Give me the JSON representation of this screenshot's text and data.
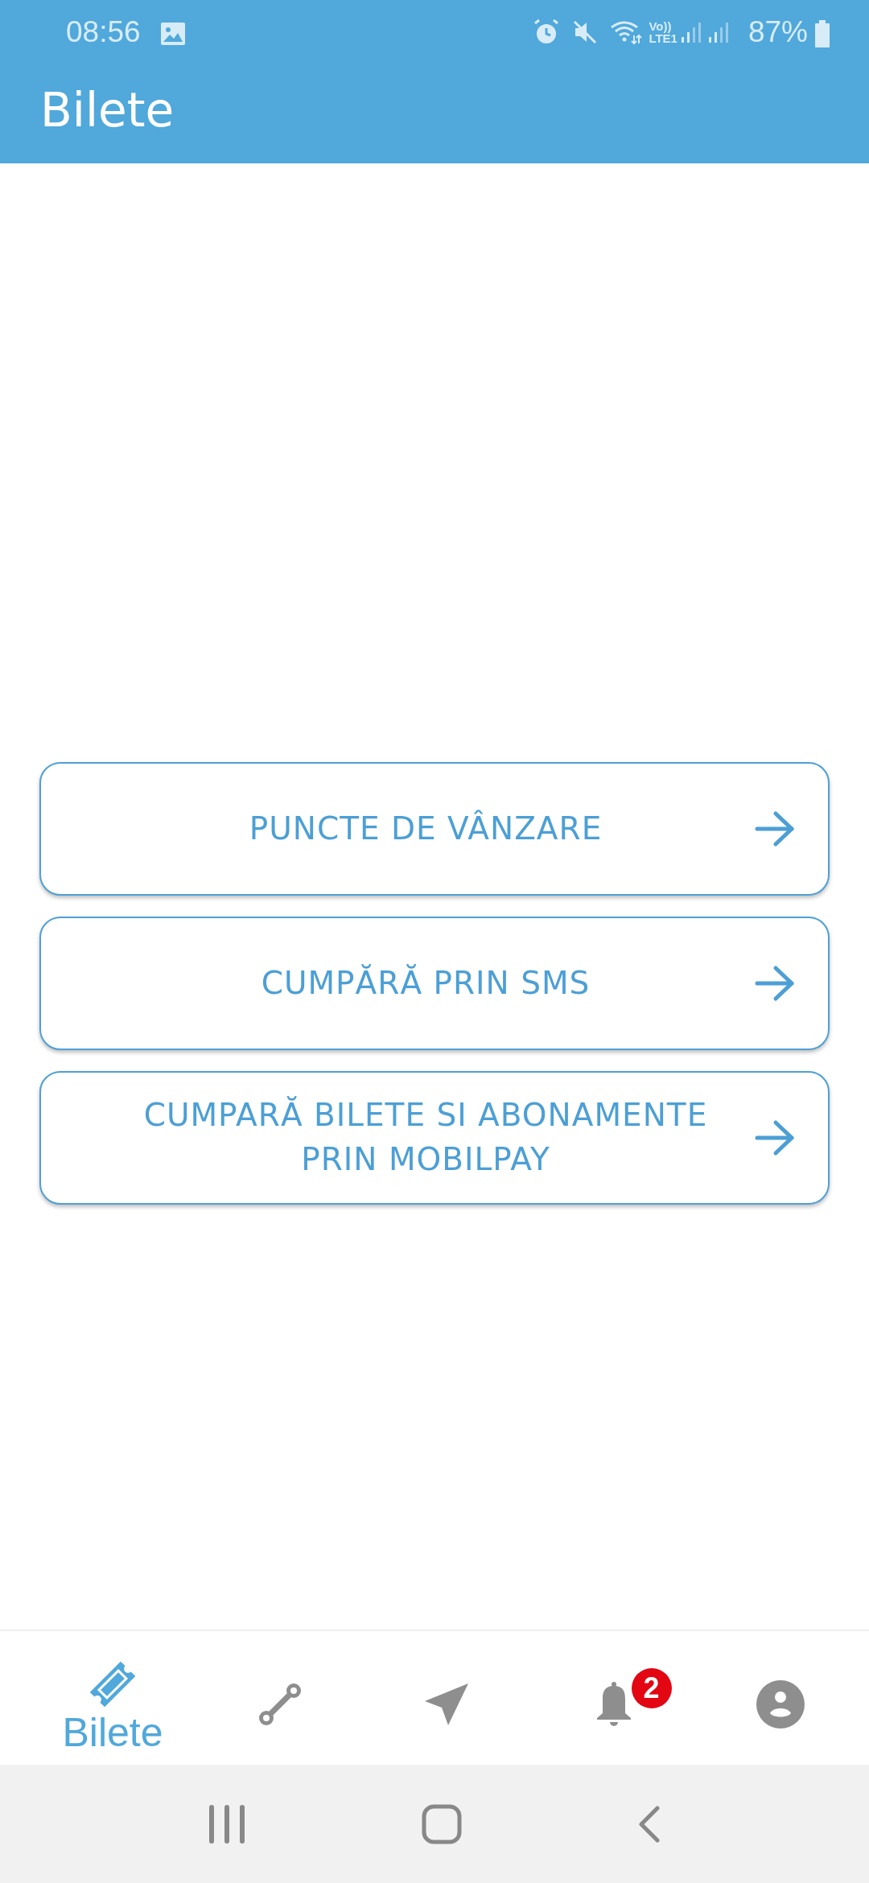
{
  "status_bar": {
    "time": "08:56",
    "network_top": "Vo))",
    "network_bottom": "LTE1",
    "battery": "87%"
  },
  "header": {
    "title": "Bilete"
  },
  "buttons": [
    {
      "label": "PUNCTE DE VÂNZARE"
    },
    {
      "label": "CUMPĂRĂ PRIN SMS"
    },
    {
      "label": "CUMPARĂ BILETE SI ABONAMENTE PRIN MOBILPAY"
    }
  ],
  "bottom_nav": [
    {
      "label": "Bilete",
      "selected": true
    },
    {
      "selected": false
    },
    {
      "selected": false
    },
    {
      "selected": false,
      "badge": "2"
    },
    {
      "selected": false
    }
  ]
}
